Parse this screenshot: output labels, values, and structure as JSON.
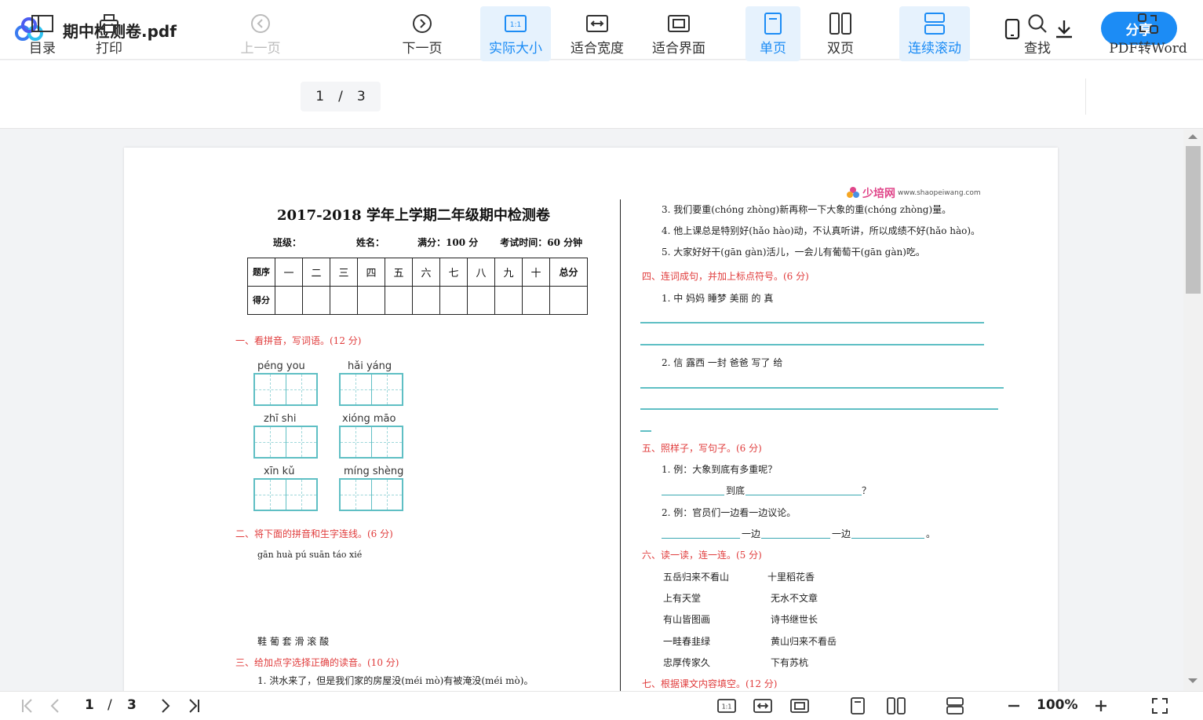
{
  "header": {
    "title": "期中检测卷.pdf",
    "share_label": "分享"
  },
  "toolbar": {
    "toc": "目录",
    "print": "打印",
    "prev": "上一页",
    "current_page": "1",
    "page_sep": "/",
    "total_pages": "3",
    "next": "下一页",
    "actual_size": "实际大小",
    "fit_width": "适合宽度",
    "fit_screen": "适合界面",
    "single_page": "单页",
    "double_page": "双页",
    "continuous": "连续滚动",
    "find": "查找",
    "pdf_to_word": "PDF转Word"
  },
  "doc": {
    "title": "2017-2018 学年上学期二年级期中检测卷",
    "info": [
      "班级：",
      "姓名：",
      "满分：100 分",
      "考试时间：60 分钟"
    ],
    "table_header": [
      "题序",
      "一",
      "二",
      "三",
      "四",
      "五",
      "六",
      "七",
      "八",
      "九",
      "十",
      "总分"
    ],
    "table_score_label": "得分",
    "sec1": "一、看拼音，写词语。(12 分)",
    "pinyin": [
      "péng  you",
      "hǎi  yáng",
      "zhī   shi",
      "xióng  māo",
      "xīn    kǔ",
      "míng  shèng"
    ],
    "sec2": "二、将下面的拼音和生字连线。(6 分)",
    "sec2_pinyin": "gān   huà   pú   suān   táo   xié",
    "sec2_chars": "鞋    葡    套    滑    滚    酸",
    "sec3": "三、给加点字选择正确的读音。(10 分)",
    "sec3_q1": "1. 洪水来了，但是我们家的房屋没(méi  mò)有被淹没(méi  mò)。",
    "watermark_brand": "少培网",
    "watermark_url": "www.shaopeiwang.com",
    "r_q3": "3. 我们要重(chóng  zhòng)新再称一下大象的重(chóng  zhòng)量。",
    "r_q4": "4. 他上课总是特别好(hǎo  hào)动，不认真听讲，所以成绩不好(hǎo  hào)。",
    "r_q5": "5. 大家好好干(gān  gàn)活儿，一会儿有葡萄干(gān  gàn)吃。",
    "sec4": "四、连词成句，并加上标点符号。(6 分)",
    "sec4_q1": "1. 中   妈妈   睡梦   美丽   的   真",
    "sec4_q2": "2. 信   露西   一封   爸爸   写了   给",
    "sec5": "五、照样子，写句子。(6 分)",
    "sec5_q1": "1. 例：大象到底有多重呢？",
    "sec5_q1_fill": "到底",
    "sec5_q1_end": "？",
    "sec5_q2": "2. 例：官员们一边看一边议论。",
    "sec5_q2_fill1": "一边",
    "sec5_q2_fill2": "一边",
    "sec5_q2_end": "。",
    "sec6": "六、读一读，连一连。(5 分)",
    "sec6_left": [
      "五岳归来不看山",
      "上有天堂",
      "有山皆图画",
      "一畦春韭绿",
      "忠厚传家久"
    ],
    "sec6_right": [
      "十里稻花香",
      "无水不文章",
      "诗书继世长",
      "黄山归来不看岳",
      "下有苏杭"
    ],
    "sec7": "七、根据课文内容填空。(12 分)"
  },
  "bottombar": {
    "current_page": "1",
    "sep": "/",
    "total_pages": "3",
    "zoom": "100%"
  }
}
